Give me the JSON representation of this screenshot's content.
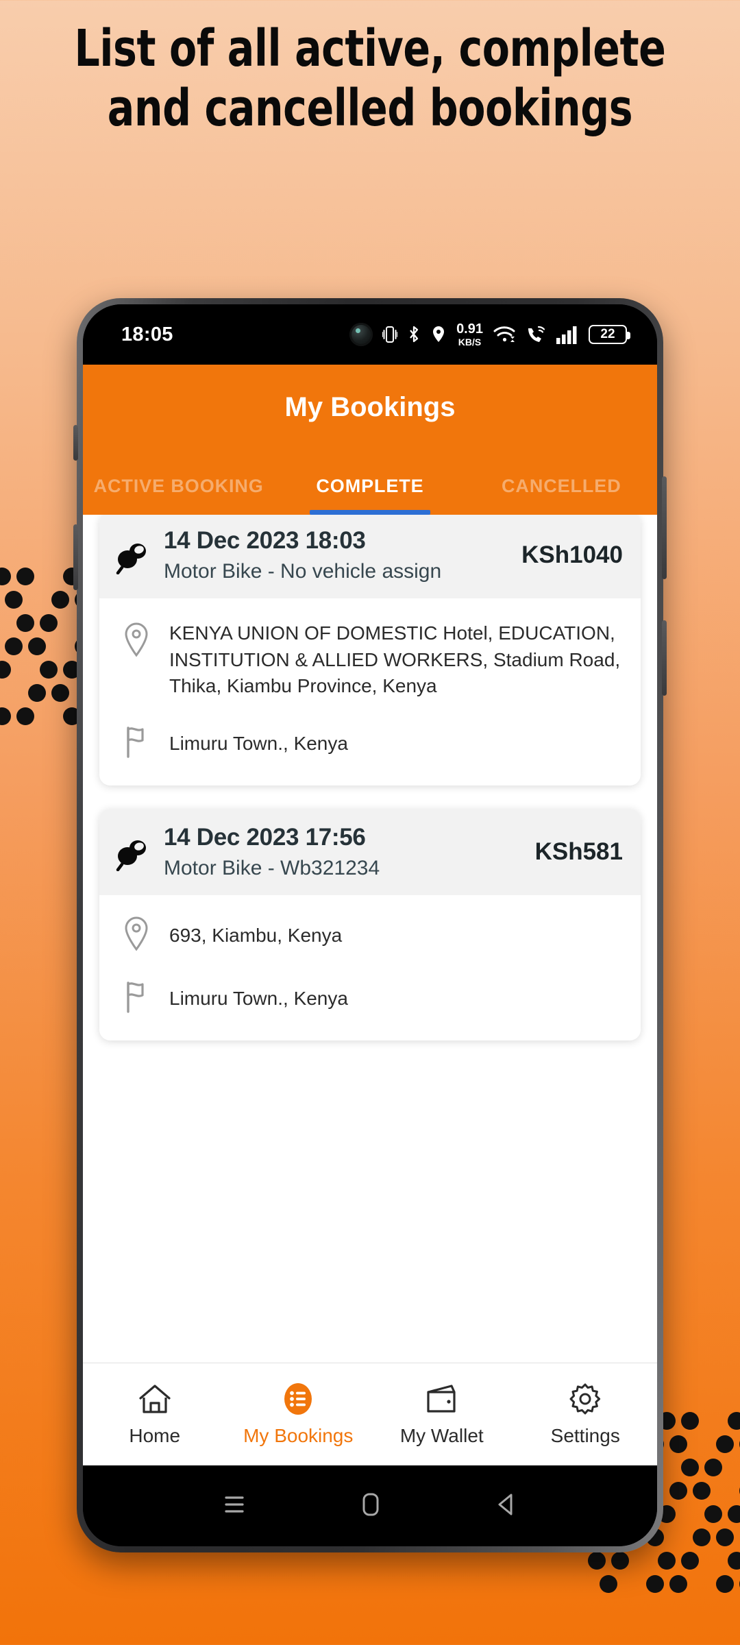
{
  "promo": {
    "heading": "List of all active, complete and cancelled bookings"
  },
  "colors": {
    "brand_orange": "#f1760c",
    "tab_indicator_blue": "#2d6fd4",
    "card_header_grey": "#f2f2f2",
    "page_bg_top": "#f8cdac",
    "page_bg_bottom": "#f2730a",
    "heading_text": "#0a0a0a"
  },
  "status_bar": {
    "time": "18:05",
    "net_speed_value": "0.91",
    "net_speed_unit": "KB/S",
    "battery_level": "22",
    "icons": [
      "camera-punch-hole-icon",
      "vibrate-icon",
      "bluetooth-icon",
      "location-pin-icon",
      "network-speed-indicator",
      "wifi-icon",
      "vowifi-call-icon",
      "signal-bars-icon",
      "battery-icon"
    ]
  },
  "header": {
    "title": "My Bookings"
  },
  "tabs": [
    {
      "label": "ACTIVE BOOKING",
      "active": false
    },
    {
      "label": "COMPLETE",
      "active": true
    },
    {
      "label": "CANCELLED",
      "active": false
    }
  ],
  "bookings": [
    {
      "date": "14 Dec 2023 18:03",
      "vehicle": "Motor Bike - No vehicle assign",
      "fare": "KSh1040",
      "pickup": "KENYA UNION OF DOMESTIC Hotel, EDUCATION, INSTITUTION & ALLIED WORKERS, Stadium Road, Thika, Kiambu Province, Kenya",
      "dropoff": "Limuru Town., Kenya"
    },
    {
      "date": "14 Dec 2023 17:56",
      "vehicle": "Motor Bike - Wb321234",
      "fare": "KSh581",
      "pickup": "693, Kiambu, Kenya",
      "dropoff": "Limuru Town., Kenya"
    }
  ],
  "bottom_nav": [
    {
      "label": "Home",
      "icon": "home-icon",
      "active": false
    },
    {
      "label": "My Bookings",
      "icon": "bookings-list-icon",
      "active": true
    },
    {
      "label": "My Wallet",
      "icon": "wallet-icon",
      "active": false
    },
    {
      "label": "Settings",
      "icon": "gear-icon",
      "active": false
    }
  ],
  "android_nav": [
    {
      "icon": "recents-icon"
    },
    {
      "icon": "home-square-icon"
    },
    {
      "icon": "back-triangle-icon"
    }
  ]
}
